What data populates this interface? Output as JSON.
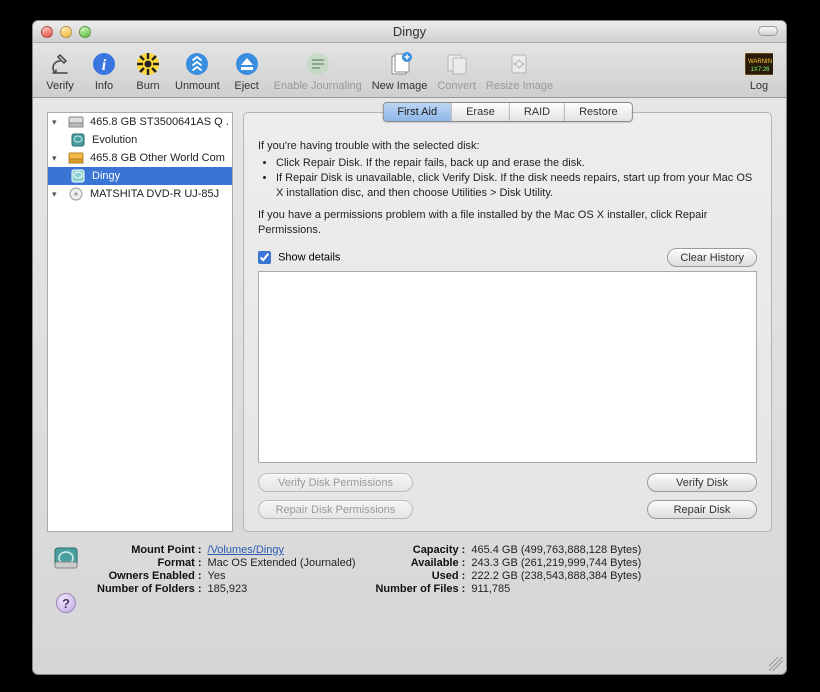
{
  "window": {
    "title": "Dingy"
  },
  "toolbar": {
    "verify": "Verify",
    "info": "Info",
    "burn": "Burn",
    "unmount": "Unmount",
    "eject": "Eject",
    "enable_journaling": "Enable Journaling",
    "new_image": "New Image",
    "convert": "Convert",
    "resize_image": "Resize Image",
    "log": "Log"
  },
  "sidebar": [
    {
      "label": "465.8 GB ST3500641AS Q .",
      "icon": "hdd"
    },
    {
      "label": "Evolution",
      "icon": "ext-vol",
      "child": true
    },
    {
      "label": "465.8 GB Other World Com",
      "icon": "ext-hdd"
    },
    {
      "label": "Dingy",
      "icon": "ext-vol",
      "child": true,
      "selected": true
    },
    {
      "label": "MATSHITA DVD-R UJ-85J",
      "icon": "optical"
    }
  ],
  "tabs": [
    "First Aid",
    "Erase",
    "RAID",
    "Restore"
  ],
  "active_tab": "First Aid",
  "intro": {
    "lead": "If you're having trouble with the selected disk:",
    "bullets": [
      "Click Repair Disk. If the repair fails, back up and erase the disk.",
      "If Repair Disk is unavailable, click Verify Disk. If the disk needs repairs, start up from your Mac OS X installation disc, and then choose Utilities > Disk Utility."
    ],
    "para2": "If you have a permissions problem with a file installed by the Mac OS X installer, click Repair Permissions."
  },
  "show_details_label": "Show details",
  "clear_history_label": "Clear History",
  "buttons": {
    "verify_perm": "Verify Disk Permissions",
    "repair_perm": "Repair Disk Permissions",
    "verify_disk": "Verify Disk",
    "repair_disk": "Repair Disk"
  },
  "footer": {
    "left": {
      "mount_point_k": "Mount Point :",
      "mount_point_v": "/Volumes/Dingy",
      "format_k": "Format :",
      "format_v": "Mac OS Extended (Journaled)",
      "owners_k": "Owners Enabled :",
      "owners_v": "Yes",
      "folders_k": "Number of Folders :",
      "folders_v": "185,923"
    },
    "right": {
      "capacity_k": "Capacity :",
      "capacity_v": "465.4 GB (499,763,888,128 Bytes)",
      "available_k": "Available :",
      "available_v": "243.3 GB (261,219,999,744 Bytes)",
      "used_k": "Used :",
      "used_v": "222.2 GB (238,543,888,384 Bytes)",
      "files_k": "Number of Files :",
      "files_v": "911,785"
    }
  }
}
